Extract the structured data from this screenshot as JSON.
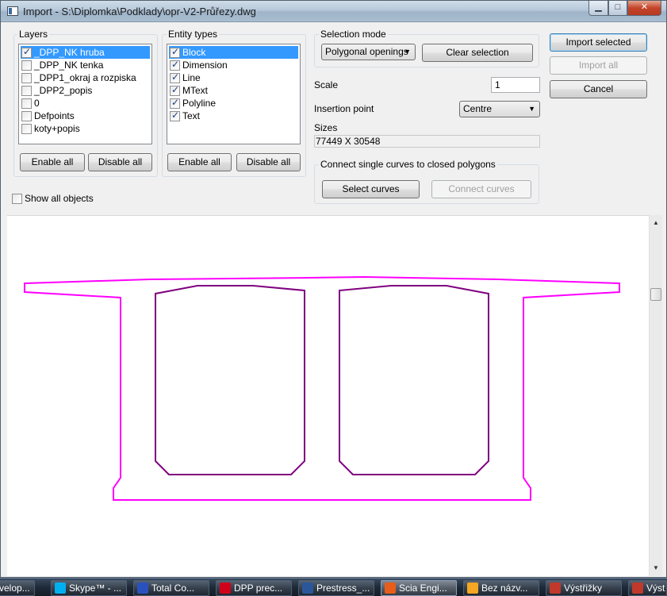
{
  "window": {
    "title": "Import - S:\\Diplomka\\Podklady\\opr-V2-Průřezy.dwg",
    "min_glyph": "▁",
    "max_glyph": "□",
    "close_glyph": "✕"
  },
  "layers": {
    "title": "Layers",
    "items": [
      {
        "label": "_DPP_NK hruba",
        "checked": true,
        "selected": true
      },
      {
        "label": "_DPP_NK tenka",
        "checked": false,
        "selected": false
      },
      {
        "label": "_DPP1_okraj a rozpiska",
        "checked": false,
        "selected": false
      },
      {
        "label": "_DPP2_popis",
        "checked": false,
        "selected": false
      },
      {
        "label": "0",
        "checked": false,
        "selected": false
      },
      {
        "label": "Defpoints",
        "checked": false,
        "selected": false
      },
      {
        "label": "koty+popis",
        "checked": false,
        "selected": false
      }
    ],
    "enable_all": "Enable all",
    "disable_all": "Disable all"
  },
  "entity_types": {
    "title": "Entity types",
    "items": [
      {
        "label": "Block",
        "checked": true,
        "selected": true
      },
      {
        "label": "Dimension",
        "checked": true,
        "selected": false
      },
      {
        "label": "Line",
        "checked": true,
        "selected": false
      },
      {
        "label": "MText",
        "checked": true,
        "selected": false
      },
      {
        "label": "Polyline",
        "checked": true,
        "selected": false
      },
      {
        "label": "Text",
        "checked": true,
        "selected": false
      }
    ],
    "enable_all": "Enable all",
    "disable_all": "Disable all"
  },
  "selection_mode": {
    "title": "Selection mode",
    "value": "Polygonal openings",
    "clear": "Clear selection"
  },
  "scale": {
    "label": "Scale",
    "value": "1"
  },
  "insertion_point": {
    "label": "Insertion point",
    "value": "Centre"
  },
  "sizes": {
    "label": "Sizes",
    "value": "77449 X 30548"
  },
  "connect": {
    "title": "Connect single curves to closed polygons",
    "select": "Select curves",
    "connect": "Connect curves"
  },
  "actions": {
    "import_selected": "Import selected",
    "import_all": "Import all",
    "cancel": "Cancel"
  },
  "show_all_objects": {
    "label": "Show all objects",
    "checked": false
  },
  "drawing": {
    "outer_color": "#ff00ff",
    "inner_color": "#800080"
  },
  "scrollbar": {
    "up_glyph": "▲",
    "down_glyph": "▼"
  },
  "taskbar": {
    "items": [
      {
        "label": "velop...",
        "icon_color": "#5a7fb0",
        "active": false
      },
      {
        "label": "Skype™ - ...",
        "icon_color": "#00aff0",
        "active": false
      },
      {
        "label": "Total Co...",
        "icon_color": "#2a52be",
        "active": false
      },
      {
        "label": "DPP prec...",
        "icon_color": "#d0021b",
        "active": false
      },
      {
        "label": "Prestress_...",
        "icon_color": "#2b579a",
        "active": false
      },
      {
        "label": "Scia Engi...",
        "icon_color": "#e85d1a",
        "active": true
      },
      {
        "label": "Bez názv...",
        "icon_color": "#f5a623",
        "active": false
      },
      {
        "label": "Výstřižky",
        "icon_color": "#c0392b",
        "active": false
      },
      {
        "label": "Výst",
        "icon_color": "#c0392b",
        "active": false
      }
    ]
  }
}
